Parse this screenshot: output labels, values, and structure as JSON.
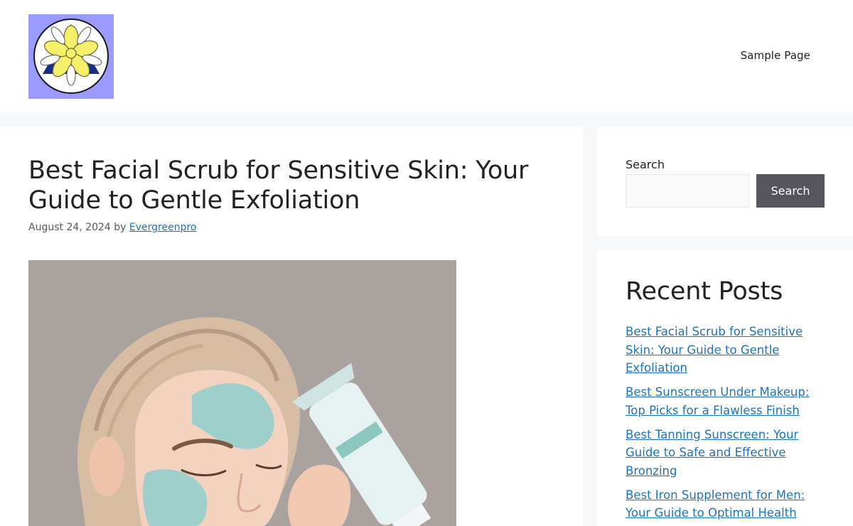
{
  "header": {
    "logo_alt": "Site logo",
    "nav": [
      {
        "label": "Sample Page"
      }
    ]
  },
  "article": {
    "title": "Best Facial Scrub for Sensitive Skin: Your Guide to Gentle Exfoliation",
    "date": "August 24, 2024",
    "by": "by",
    "author": "Evergreenpro"
  },
  "sidebar": {
    "search": {
      "label": "Search",
      "input_value": "",
      "button_label": "Search"
    },
    "recent_posts": {
      "title": "Recent Posts",
      "items": [
        {
          "label": "Best Facial Scrub for Sensitive Skin: Your Guide to Gentle Exfoliation"
        },
        {
          "label": "Best Sunscreen Under Makeup: Top Picks for a Flawless Finish"
        },
        {
          "label": "Best Tanning Sunscreen: Your Guide to Safe and Effective Bronzing"
        },
        {
          "label": "Best Iron Supplement for Men: Your Guide to Optimal Health"
        }
      ]
    }
  },
  "colors": {
    "page_bg": "#f7f8f9",
    "link": "#1e73be",
    "button_bg": "#55555e",
    "logo_bg": "#9b9bff"
  }
}
